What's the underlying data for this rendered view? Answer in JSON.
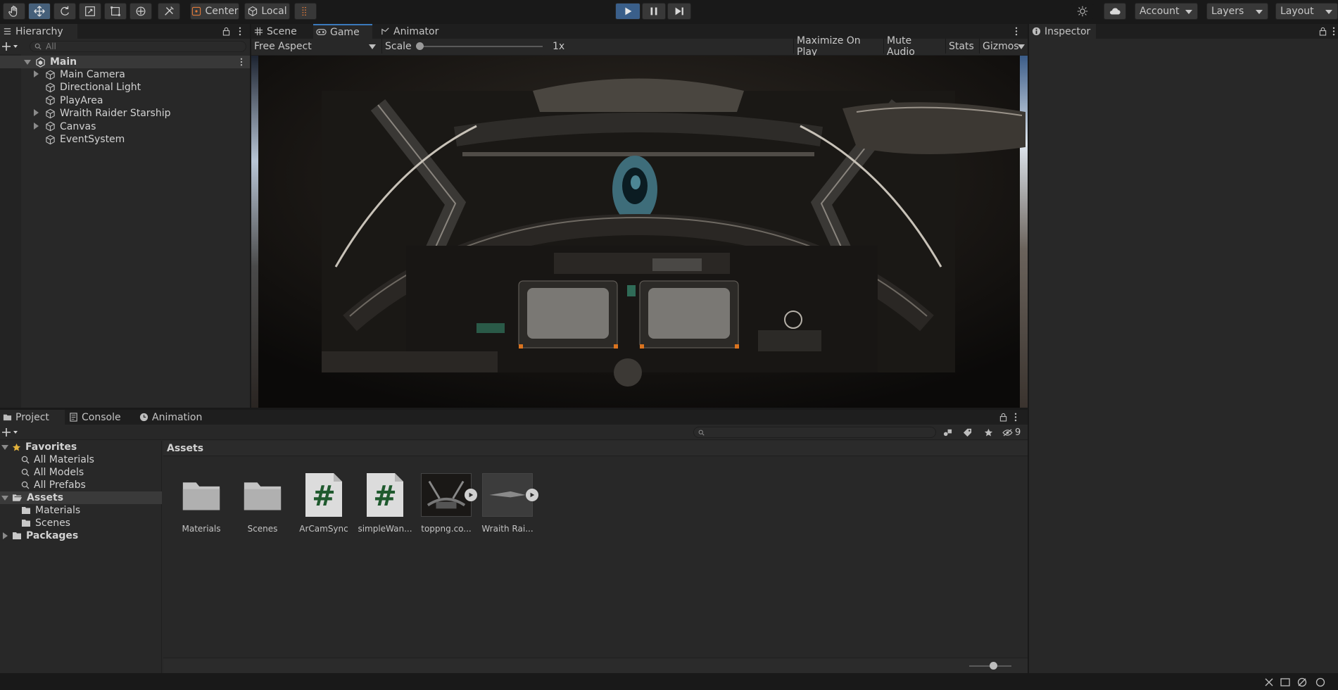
{
  "toolbar": {
    "pivot_label": "Center",
    "space_label": "Local",
    "account_label": "Account",
    "layers_label": "Layers",
    "layout_label": "Layout"
  },
  "hierarchy": {
    "tab_label": "Hierarchy",
    "search_placeholder": "All",
    "scene_name": "Main",
    "items": [
      {
        "label": "Main Camera",
        "expandable": true
      },
      {
        "label": "Directional Light",
        "expandable": false
      },
      {
        "label": "PlayArea",
        "expandable": false
      },
      {
        "label": "Wraith Raider Starship",
        "expandable": true
      },
      {
        "label": "Canvas",
        "expandable": true
      },
      {
        "label": "EventSystem",
        "expandable": false
      }
    ]
  },
  "center_tabs": {
    "scene": "Scene",
    "game": "Game",
    "animator": "Animator"
  },
  "game_toolbar": {
    "aspect": "Free Aspect",
    "scale_label": "Scale",
    "scale_value": "1x",
    "maximize": "Maximize On Play",
    "mute": "Mute Audio",
    "stats": "Stats",
    "gizmos": "Gizmos"
  },
  "inspector": {
    "tab_label": "Inspector"
  },
  "bottom_tabs": {
    "project": "Project",
    "console": "Console",
    "animation": "Animation"
  },
  "project": {
    "hidden_count": "9",
    "favorites_label": "Favorites",
    "favorites": [
      "All Materials",
      "All Models",
      "All Prefabs"
    ],
    "assets_label": "Assets",
    "asset_folders": [
      "Materials",
      "Scenes"
    ],
    "packages_label": "Packages",
    "breadcrumb": "Assets",
    "assets": [
      {
        "label": "Materials",
        "kind": "folder-icon"
      },
      {
        "label": "Scenes",
        "kind": "folder-icon"
      },
      {
        "label": "ArCamSync",
        "kind": "script-icon"
      },
      {
        "label": "simpleWan...",
        "kind": "script-icon"
      },
      {
        "label": "toppng.co...",
        "kind": "model-icon"
      },
      {
        "label": "Wraith Rai...",
        "kind": "model-icon"
      }
    ]
  },
  "colors": {
    "accent": "#3a79bb",
    "panel": "#282828",
    "toolbar": "#191919",
    "play_active": "#3a5f8a",
    "script_hash": "#1f5a2e"
  }
}
